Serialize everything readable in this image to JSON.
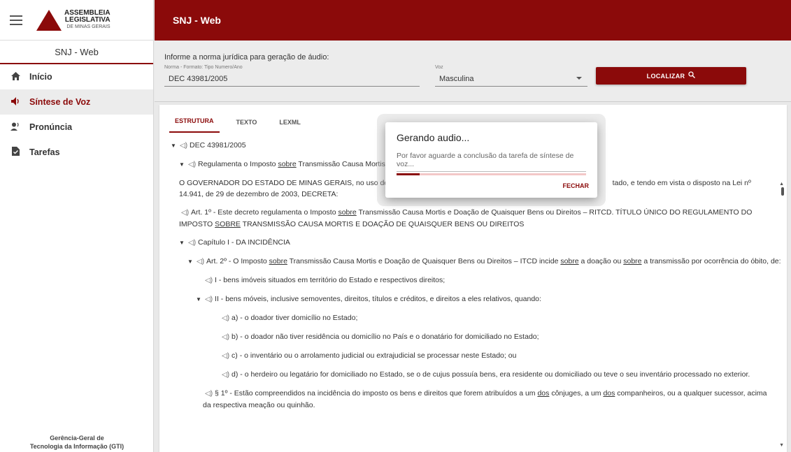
{
  "sidebar": {
    "logo": {
      "line1": "ASSEMBLEIA",
      "line2": "LEGISLATIVA",
      "line3": "DE MINAS GERAIS"
    },
    "subtitle": "SNJ - Web",
    "items": [
      {
        "label": "Início",
        "icon": "home-icon",
        "glyph": "🏠"
      },
      {
        "label": "Síntese de Voz",
        "icon": "speaker-icon",
        "glyph": "🔊"
      },
      {
        "label": "Pronúncia",
        "icon": "speaking-person-icon",
        "glyph": "👤"
      },
      {
        "label": "Tarefas",
        "icon": "document-icon",
        "glyph": "📄"
      }
    ],
    "footer_line1": "Gerência-Geral de",
    "footer_line2": "Tecnologia da Informação (GTI)"
  },
  "topbar": {
    "title": "SNJ - Web"
  },
  "form": {
    "label": "Informe a norma jurídica para geração de áudio:",
    "norma_label": "Norma - Formato: Tipo Numero/Ano",
    "norma_value": "DEC 43981/2005",
    "voz_label": "Voz",
    "voz_value": "Masculina",
    "localizar_label": "LOCALIZAR"
  },
  "tabs": [
    "ESTRUTURA",
    "TEXTO",
    "LEXML"
  ],
  "tree": {
    "r1": "DEC 43981/2005",
    "r2a": "Regulamenta o Imposto ",
    "r2u": "sobre",
    "r2b": " Transmissão Causa Mortis",
    "r3a": "O GOVERNADOR DO ESTADO DE MINAS GERAIS, no uso de atri",
    "r3b": "tado, e tendo em vista o disposto na Lei nº 14.941, de 29 de dezembro de 2003, DECRETA:",
    "r4a": "Art. 1º - Este decreto regulamenta o Imposto ",
    "r4u": "sobre",
    "r4b": " Transmissão Causa Mortis e Doação de Quaisquer Bens ou Direitos – RITCD. TÍTULO ÚNICO DO REGULAMENTO DO IMPOSTO ",
    "r4u2": "SOBRE",
    "r4c": " TRANSMISSÃO CAUSA MORTIS E DOAÇÃO DE QUAISQUER BENS OU DIREITOS",
    "r5": "Capítulo I - DA INCIDÊNCIA",
    "r6a": "Art. 2º - O Imposto ",
    "r6u": "sobre",
    "r6b": " Transmissão Causa Mortis e Doação de Quaisquer Bens ou Direitos – ITCD incide ",
    "r6u2": "sobre",
    "r6c": " a doação ou ",
    "r6u3": "sobre",
    "r6d": " a transmissão por ocorrência do óbito, de:",
    "r7": "I - bens imóveis situados em território do Estado e respectivos direitos;",
    "r8": "II - bens móveis, inclusive semoventes, direitos, títulos e créditos, e direitos a eles relativos, quando:",
    "r9": "a) - o doador tiver domicílio no Estado;",
    "r10": "b) - o doador não tiver residência ou domicílio no País e o donatário for domiciliado no Estado;",
    "r11": "c) - o inventário ou o arrolamento judicial ou extrajudicial se processar neste Estado; ou",
    "r12": "d) - o herdeiro ou legatário for domiciliado no Estado, se o de cujus possuía bens, era residente ou domiciliado ou teve o seu inventário processado no exterior.",
    "r13a": "§ 1º - Estão compreendidos na incidência do imposto os bens e direitos que forem atribuídos a um ",
    "r13u": "dos",
    "r13b": " cônjuges, a um ",
    "r13u2": "dos",
    "r13c": " companheiros, ou a qualquer sucessor, acima da respectiva meação ou quinhão."
  },
  "dialog": {
    "title": "Gerando audio...",
    "message": "Por favor aguarde a conclusão da tarefa de síntese de voz...",
    "progress": 0.12,
    "close_label": "FECHAR"
  },
  "colors": {
    "brand": "#8b0a0a"
  }
}
